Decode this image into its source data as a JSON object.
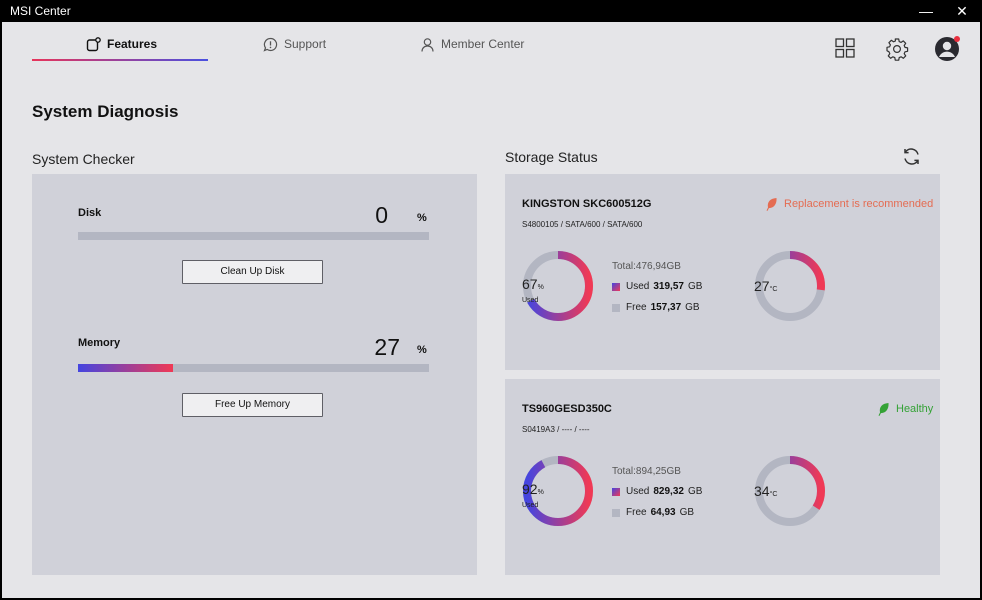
{
  "window": {
    "title": "MSI Center",
    "minimize": "—",
    "close": "✕"
  },
  "tabs": [
    {
      "label": "Features",
      "icon": "features-icon"
    },
    {
      "label": "Support",
      "icon": "support-icon"
    },
    {
      "label": "Member Center",
      "icon": "member-icon"
    }
  ],
  "header_icons": [
    "grid-icon",
    "gear-icon",
    "avatar"
  ],
  "page_title": "System Diagnosis",
  "system_checker": {
    "title": "System Checker",
    "disk": {
      "label": "Disk",
      "value": "0",
      "unit": "%",
      "fraction": 0,
      "button": "Clean Up Disk"
    },
    "memory": {
      "label": "Memory",
      "value": "27",
      "unit": "%",
      "fraction": 0.27,
      "button": "Free Up Memory"
    }
  },
  "storage": {
    "title": "Storage Status",
    "refresh_icon": "refresh-icon",
    "drives": [
      {
        "name": "KINGSTON SKC600512G",
        "sub": "S4800105 / SATA/600 / SATA/600",
        "status": "Replacement is recommended",
        "status_type": "warn",
        "usage_pct": "67",
        "usage_fraction": 0.67,
        "usage_label": "Used",
        "pct_unit": "%",
        "total": "Total:476,94GB",
        "used_label": "Used",
        "used_value": "319,57",
        "free_label": "Free",
        "free_value": "157,37",
        "gb": "GB",
        "temp": "27",
        "temp_unit": "°C",
        "temp_fraction": 0.27
      },
      {
        "name": "TS960GESD350C",
        "sub": "S0419A3 / ---- / ----",
        "status": "Healthy",
        "status_type": "ok",
        "usage_pct": "92",
        "usage_fraction": 0.92,
        "usage_label": "Used",
        "pct_unit": "%",
        "total": "Total:894,25GB",
        "used_label": "Used",
        "used_value": "829,32",
        "free_label": "Free",
        "free_value": "64,93",
        "gb": "GB",
        "temp": "34",
        "temp_unit": "°C",
        "temp_fraction": 0.34
      }
    ]
  },
  "colors": {
    "gradient_start": "#4445e0",
    "gradient_end": "#f03955",
    "track": "#b3b6c2",
    "warn": "#e46c52",
    "ok": "#34a236"
  }
}
